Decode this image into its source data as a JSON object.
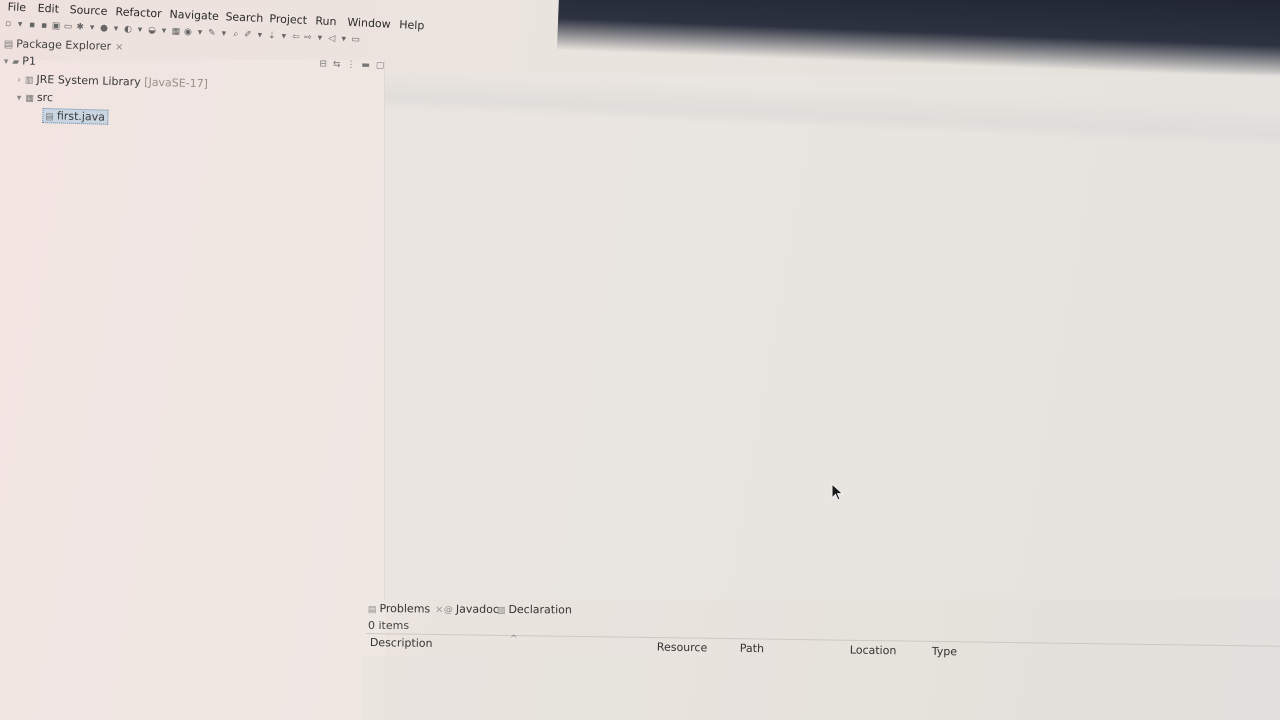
{
  "menu": {
    "items": [
      "File",
      "Edit",
      "Source",
      "Refactor",
      "Navigate",
      "Search",
      "Project",
      "Run",
      "Window",
      "Help"
    ]
  },
  "package_explorer": {
    "title": "Package Explorer",
    "close_glyph": "×",
    "tree": {
      "project": "P1",
      "jre_label": "JRE System Library",
      "jre_version": "[JavaSE-17]",
      "src": "src",
      "file": "first.java"
    }
  },
  "bottom_panel": {
    "tabs": {
      "problems": "Problems",
      "javadoc": "Javadoc",
      "declaration": "Declaration"
    },
    "close_glyph": "×",
    "items_count": "0 items",
    "columns": {
      "description": "Description",
      "resource": "Resource",
      "path": "Path",
      "location": "Location",
      "type": "Type"
    }
  },
  "colors": {
    "selection_bg": "#c9d6e2",
    "dark_band": "#202531"
  }
}
